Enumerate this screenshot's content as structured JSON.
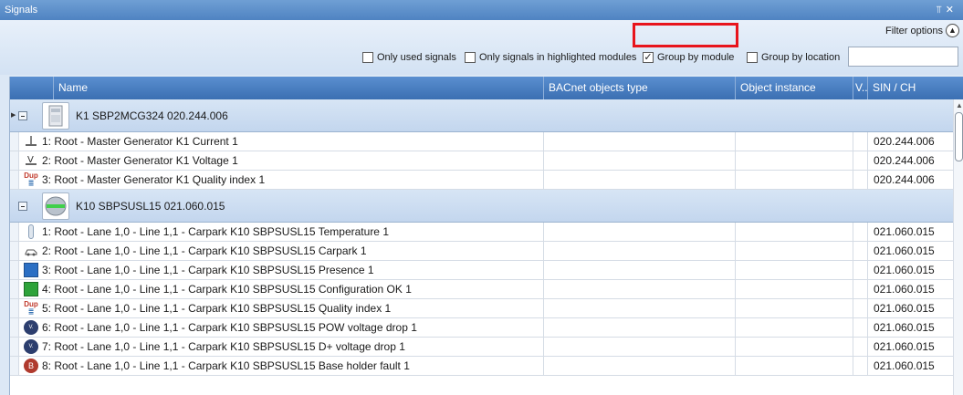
{
  "window": {
    "title": "Signals",
    "pin_icon": "pin-icon",
    "close_icon": "close-icon"
  },
  "filter": {
    "options_label": "Filter options",
    "checkboxes": [
      {
        "label": "Only used signals",
        "checked": false
      },
      {
        "label": "Only signals in highlighted modules",
        "checked": false
      },
      {
        "label": "Group by module",
        "checked": true
      },
      {
        "label": "Group by location",
        "checked": false
      }
    ],
    "search_value": ""
  },
  "columns": {
    "name": "Name",
    "bacnet": "BACnet objects type",
    "instance": "Object instance",
    "v": "V..",
    "sin": "SIN / CH"
  },
  "groups": [
    {
      "title": "K1 SBP2MCG324   020.244.006",
      "rows": [
        {
          "icon": "current-icon",
          "name": "1: Root - Master Generator K1 Current 1",
          "bacnet": "",
          "instance": "",
          "sin": "020.244.006"
        },
        {
          "icon": "voltage-icon",
          "name": "2: Root - Master Generator K1 Voltage 1",
          "bacnet": "",
          "instance": "",
          "sin": "020.244.006"
        },
        {
          "icon": "dup-quality-icon",
          "name": "3: Root - Master Generator K1 Quality index 1",
          "bacnet": "",
          "instance": "",
          "sin": "020.244.006"
        }
      ]
    },
    {
      "title": "K10 SBPSUSL15   021.060.015",
      "rows": [
        {
          "icon": "thermometer-icon",
          "name": "1: Root - Lane 1,0 - Line 1,1 - Carpark K10 SBPSUSL15 Temperature 1",
          "bacnet": "",
          "instance": "",
          "sin": "021.060.015"
        },
        {
          "icon": "car-icon",
          "name": "2: Root - Lane 1,0 - Line 1,1 - Carpark K10 SBPSUSL15 Carpark 1",
          "bacnet": "",
          "instance": "",
          "sin": "021.060.015"
        },
        {
          "icon": "presence-icon",
          "name": "3: Root - Lane 1,0 - Line 1,1 - Carpark K10 SBPSUSL15 Presence 1",
          "bacnet": "",
          "instance": "",
          "sin": "021.060.015"
        },
        {
          "icon": "configuration-ok-icon",
          "name": "4: Root - Lane 1,0 - Line 1,1 - Carpark K10 SBPSUSL15 Configuration OK 1",
          "bacnet": "",
          "instance": "",
          "sin": "021.060.015"
        },
        {
          "icon": "dup-quality-icon",
          "name": "5: Root - Lane 1,0 - Line 1,1 - Carpark K10 SBPSUSL15 Quality index 1",
          "bacnet": "",
          "instance": "",
          "sin": "021.060.015"
        },
        {
          "icon": "voltage-drop-icon",
          "name": "6: Root - Lane 1,0 - Line 1,1 - Carpark K10 SBPSUSL15 POW voltage drop 1",
          "bacnet": "",
          "instance": "",
          "sin": "021.060.015"
        },
        {
          "icon": "voltage-drop-icon",
          "name": "7: Root - Lane 1,0 - Line 1,1 - Carpark K10 SBPSUSL15 D+ voltage drop 1",
          "bacnet": "",
          "instance": "",
          "sin": "021.060.015"
        },
        {
          "icon": "base-holder-fault-icon",
          "name": "8: Root - Lane 1,0 - Line 1,1 - Carpark K10 SBPSUSL15 Base holder fault 1",
          "bacnet": "",
          "instance": "",
          "sin": "021.060.015"
        }
      ]
    }
  ],
  "icon_text": {
    "dup_top": "Dup",
    "voltage": "V",
    "vdrop": "V.",
    "fault": "B"
  },
  "colors": {
    "title_bar": "#4f83c2",
    "header": "#3b6fb2",
    "group_band": "#c3d6ee",
    "highlight": "#e8141c"
  }
}
